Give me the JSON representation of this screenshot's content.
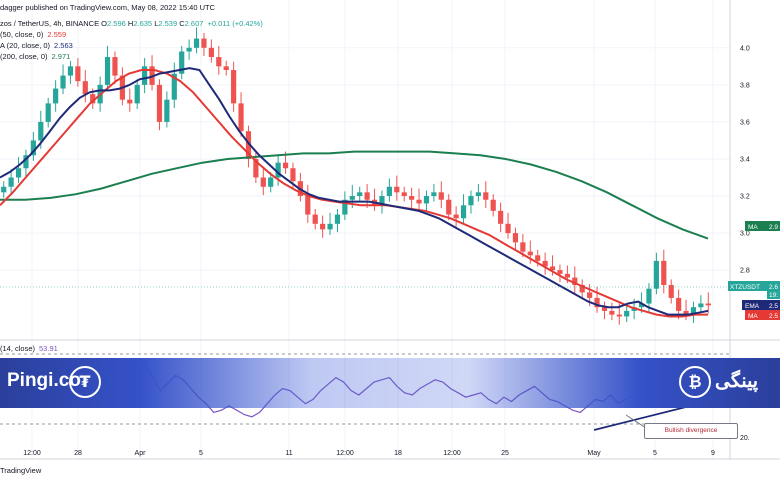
{
  "header": {
    "published": "dagger published on TradingView.com, May 08, 2022 15:40 UTC",
    "symbol": "zos / TetherUS, 4h, BINANCE",
    "o_label": "O",
    "o": "2.596",
    "h_label": "H",
    "h": "2.635",
    "l_label": "L",
    "l": "2.539",
    "c_label": "C",
    "c": "2.607",
    "change": "+0.011 (+0.42%)",
    "ind1": "(50, close, 0)",
    "ind1_val": "2.559",
    "ind2": "A (20, close, 0)",
    "ind2_val": "2.563",
    "ind3": "(200, close, 0)",
    "ind3_val": "2.971",
    "rsi": "(14, close)",
    "rsi_val": "53.91"
  },
  "price_axis_labels": [
    "4.0",
    "3.8",
    "3.6",
    "3.4",
    "3.2",
    "3.0",
    "2.8"
  ],
  "rsi_axis_labels": [
    "40.",
    "20."
  ],
  "tags": {
    "ma200": {
      "label": "MA",
      "value": "2.9"
    },
    "symbol": {
      "label": "XTZUSDT",
      "value": "2.6",
      "sub": "19:"
    },
    "ema": {
      "label": "EMA",
      "value": "2.5"
    },
    "ma50": {
      "label": "MA",
      "value": "2.5"
    }
  },
  "time_axis_labels": [
    "12:00",
    "28",
    "Apr",
    "5",
    "11",
    "12:00",
    "18",
    "12:00",
    "25",
    "May",
    "5",
    "9"
  ],
  "annotation": "Bullish divergence",
  "watermark_left": "Pingi.co",
  "watermark_right": "پینگی",
  "logo_left_glyph": "₮",
  "logo_right_glyph": "₿",
  "tv_logo": "TradingView",
  "colors": {
    "up": "#26a69a",
    "down": "#ef5350",
    "ema20": "#1e2a78",
    "ma50": "#e53935",
    "ma200": "#1b7f4f",
    "rsi": "#7e57c2",
    "banner": "#3552c9"
  },
  "chart_data": {
    "type": "candlestick",
    "pair": "XTZ/USDT",
    "timeframe": "4h",
    "ylim": [
      2.45,
      4.15
    ],
    "rsi_range": [
      20,
      80
    ],
    "close_series": [
      3.25,
      3.3,
      3.35,
      3.42,
      3.5,
      3.6,
      3.7,
      3.78,
      3.85,
      3.9,
      3.82,
      3.75,
      3.7,
      3.8,
      3.95,
      3.85,
      3.72,
      3.7,
      3.8,
      3.9,
      3.8,
      3.6,
      3.72,
      3.86,
      3.98,
      4.0,
      4.05,
      4.0,
      3.95,
      3.9,
      3.88,
      3.7,
      3.55,
      3.4,
      3.3,
      3.25,
      3.3,
      3.38,
      3.35,
      3.28,
      3.2,
      3.1,
      3.05,
      3.02,
      3.05,
      3.1,
      3.18,
      3.2,
      3.22,
      3.18,
      3.15,
      3.2,
      3.25,
      3.22,
      3.2,
      3.18,
      3.16,
      3.2,
      3.22,
      3.18,
      3.1,
      3.08,
      3.15,
      3.2,
      3.22,
      3.18,
      3.12,
      3.05,
      3.0,
      2.95,
      2.9,
      2.88,
      2.85,
      2.82,
      2.8,
      2.78,
      2.76,
      2.72,
      2.68,
      2.65,
      2.6,
      2.58,
      2.56,
      2.55,
      2.58,
      2.6,
      2.62,
      2.7,
      2.85,
      2.72,
      2.65,
      2.58,
      2.56,
      2.6,
      2.62,
      2.61
    ],
    "ema20_series": [
      3.3,
      3.33,
      3.37,
      3.42,
      3.48,
      3.55,
      3.62,
      3.68,
      3.73,
      3.76,
      3.77,
      3.77,
      3.78,
      3.8,
      3.83,
      3.84,
      3.86,
      3.87,
      3.88,
      3.89,
      3.88,
      3.8,
      3.72,
      3.63,
      3.55,
      3.48,
      3.42,
      3.37,
      3.32,
      3.28,
      3.24,
      3.21,
      3.19,
      3.18,
      3.17,
      3.17,
      3.17,
      3.17,
      3.16,
      3.15,
      3.14,
      3.13,
      3.12,
      3.1,
      3.08,
      3.05,
      3.02,
      2.99,
      2.96,
      2.93,
      2.9,
      2.87,
      2.84,
      2.81,
      2.78,
      2.75,
      2.72,
      2.69,
      2.66,
      2.63,
      2.61,
      2.6,
      2.6,
      2.62,
      2.63,
      2.6,
      2.58,
      2.56,
      2.56,
      2.56,
      2.57,
      2.58
    ],
    "ma50_series": [
      3.15,
      3.22,
      3.3,
      3.38,
      3.46,
      3.54,
      3.62,
      3.7,
      3.76,
      3.82,
      3.86,
      3.88,
      3.88,
      3.86,
      3.82,
      3.76,
      3.68,
      3.6,
      3.52,
      3.45,
      3.38,
      3.32,
      3.27,
      3.23,
      3.2,
      3.18,
      3.17,
      3.16,
      3.15,
      3.15,
      3.15,
      3.14,
      3.13,
      3.12,
      3.1,
      3.08,
      3.05,
      3.02,
      2.99,
      2.95,
      2.91,
      2.87,
      2.83,
      2.79,
      2.75,
      2.72,
      2.69,
      2.66,
      2.63,
      2.6,
      2.58,
      2.56,
      2.55,
      2.55,
      2.56,
      2.56
    ],
    "ma200_series": [
      3.18,
      3.18,
      3.19,
      3.21,
      3.24,
      3.28,
      3.32,
      3.35,
      3.38,
      3.4,
      3.41,
      3.42,
      3.43,
      3.43,
      3.44,
      3.44,
      3.44,
      3.44,
      3.43,
      3.42,
      3.4,
      3.37,
      3.33,
      3.28,
      3.22,
      3.15,
      3.08,
      3.02,
      2.97
    ],
    "rsi_series": [
      55,
      62,
      70,
      66,
      58,
      72,
      64,
      55,
      68,
      75,
      62,
      50,
      58,
      70,
      66,
      60,
      52,
      58,
      66,
      72,
      60,
      48,
      55,
      62,
      58,
      50,
      42,
      36,
      28,
      30,
      34,
      30,
      26,
      24,
      28,
      36,
      44,
      50,
      48,
      42,
      36,
      40,
      48,
      54,
      60,
      56,
      48,
      44,
      50,
      56,
      58,
      60,
      52,
      46,
      44,
      50,
      54,
      58,
      56,
      50,
      46,
      42,
      44,
      46,
      40,
      36,
      42,
      38,
      44,
      48,
      52,
      46,
      40,
      38,
      34,
      30,
      28,
      34,
      40,
      38,
      44,
      36,
      40,
      44,
      50,
      56,
      62,
      70,
      54,
      46,
      52,
      58,
      60,
      56
    ]
  }
}
